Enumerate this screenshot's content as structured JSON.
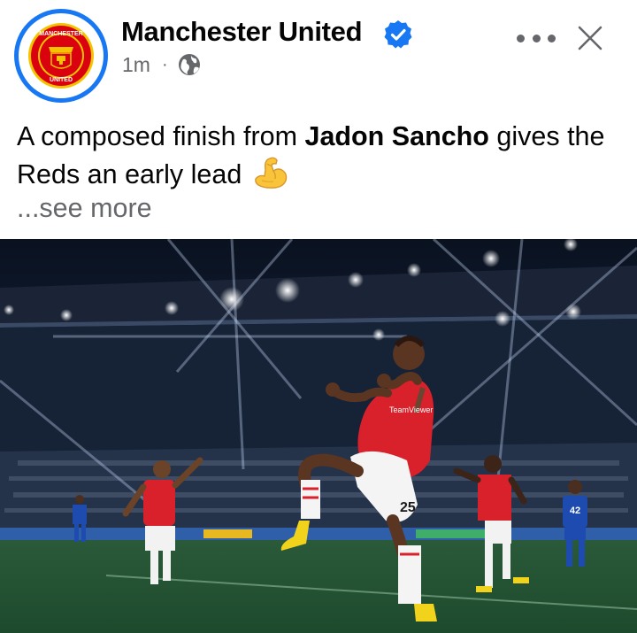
{
  "post": {
    "page_name": "Manchester United",
    "verified": true,
    "timestamp": "1m",
    "separator": "·",
    "audience_icon": "globe-icon",
    "caption": {
      "prefix": "A composed finish from ",
      "bold": "Jadon Sancho",
      "suffix": " gives the Reds an early lead",
      "emoji": "flexed-biceps-emoji"
    },
    "see_more": "...see more",
    "avatar": {
      "logo_top_text": "MANCHESTER",
      "logo_bottom_text": "UNITED"
    },
    "photo": {
      "description_icon": "football-celebration-photo",
      "shirt_sponsor": "TeamViewer",
      "shirt_number": "25",
      "opponent_number": "42"
    }
  },
  "colors": {
    "accent": "#1877f2",
    "text_primary": "#050505",
    "text_secondary": "#65676b",
    "club_red": "#da020e",
    "club_yellow": "#fbe122"
  }
}
